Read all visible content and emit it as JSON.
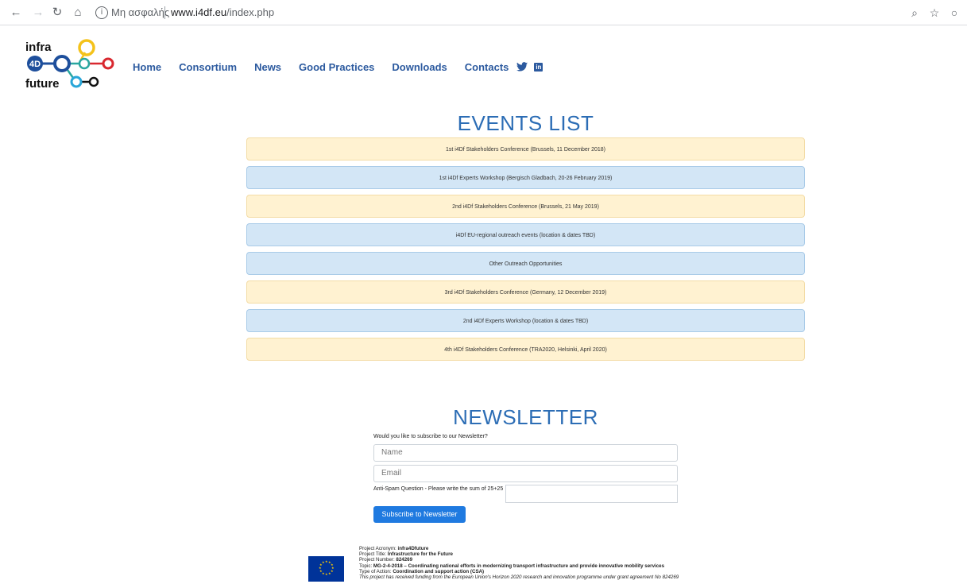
{
  "browser": {
    "security_text": "Μη ασφαλής",
    "url_host": "www.i4df.eu",
    "url_path": "/index.php"
  },
  "logo": {
    "line1": "infra",
    "badge": "4D",
    "line2": "future"
  },
  "nav": {
    "items": [
      "Home",
      "Consortium",
      "News",
      "Good Practices",
      "Downloads",
      "Contacts"
    ]
  },
  "events": {
    "title": "EVENTS LIST",
    "items": [
      {
        "label": "1st i4Df Stakeholders Conference (Brussels, 11 December 2018)",
        "color": "yellow"
      },
      {
        "label": "1st i4Df Experts Workshop (Bergisch Gladbach, 20-26 February 2019)",
        "color": "blue"
      },
      {
        "label": "2nd i4Df Stakeholders Conference (Brussels, 21 May 2019)",
        "color": "yellow"
      },
      {
        "label": "i4Df EU-regional outreach events (location & dates TBD)",
        "color": "blue"
      },
      {
        "label": "Other Outreach Opportunities",
        "color": "blue"
      },
      {
        "label": "3rd i4Df Stakeholders Conference (Germany, 12 December 2019)",
        "color": "yellow"
      },
      {
        "label": "2nd i4Df Experts Workshop (location & dates TBD)",
        "color": "blue"
      },
      {
        "label": "4th i4Df Stakeholders Conference (TRA2020, Helsinki, April 2020)",
        "color": "yellow"
      }
    ]
  },
  "newsletter": {
    "title": "NEWSLETTER",
    "question": "Would you like to subscribe to our Newsletter?",
    "name_placeholder": "Name",
    "email_placeholder": "Email",
    "spam_label": "Anti-Spam Question - Please write the sum of 25+25",
    "subscribe_label": "Subscribe to Newsletter"
  },
  "footer": {
    "acronym_label": "Project Acronym: ",
    "acronym_value": "infra4Dfuture",
    "title_label": "Project Title: ",
    "title_value": "Infrastructure for the Future",
    "number_label": "Project Number: ",
    "number_value": "824269",
    "topic_label": "Topic: ",
    "topic_value": "MG-2-4-2018 – Coordinating national efforts in modernizing transport infrastructure and provide innovative mobility services",
    "type_label": "Type of Action: ",
    "type_value": "Coordination and support action (CSA)",
    "funding": "This project has received funding from the European Union's Horizon 2020 research and innovation programme under grant agreement No 824269"
  },
  "colors": {
    "nav_link": "#2c5a9f",
    "heading": "#2c6db5",
    "event_yellow": "#fff2d1",
    "event_blue": "#d3e6f6",
    "button": "#1f7ae0"
  }
}
